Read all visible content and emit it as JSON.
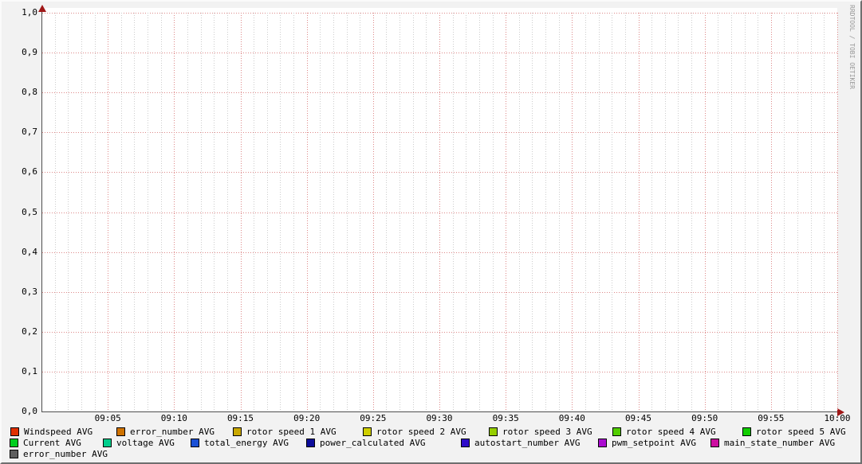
{
  "watermark": "RRDTOOL / TOBI OETIKER",
  "chart_data": {
    "type": "line",
    "title": "",
    "x_axis": {
      "range": [
        "09:00",
        "10:00"
      ],
      "tick_labels": [
        "09:05",
        "09:10",
        "09:15",
        "09:20",
        "09:25",
        "09:30",
        "09:35",
        "09:40",
        "09:45",
        "09:50",
        "09:55",
        "10:00"
      ],
      "minor_ticks_per_major": 5
    },
    "y_axis": {
      "min": 0.0,
      "max": 1.0,
      "tick_labels_top_to_bottom": [
        "1,0",
        "0,9",
        "0,8",
        "0,7",
        "0,6",
        "0,5",
        "0,4",
        "0,3",
        "0,2",
        "0,1",
        "0,0"
      ]
    },
    "grid": {
      "on": true,
      "major_color": "#dd8888",
      "minor_color": "#cccccc",
      "axis_color": "#4f4f4f",
      "arrow_color": "#a01818",
      "plot_bg": "#ffffff",
      "outer_bg": "#f2f2f2"
    },
    "legend_position": "bottom",
    "series": [
      {
        "name": "Windspeed AVG",
        "color": "#e03000",
        "values": []
      },
      {
        "name": "error_number AVG",
        "color": "#cf7300",
        "values": []
      },
      {
        "name": "rotor speed 1 AVG",
        "color": "#c9a800",
        "values": []
      },
      {
        "name": "rotor speed 2 AVG",
        "color": "#cfcf00",
        "values": []
      },
      {
        "name": "rotor speed 3 AVG",
        "color": "#95ce00",
        "values": []
      },
      {
        "name": "rotor speed 4 AVG",
        "color": "#52ce00",
        "values": []
      },
      {
        "name": "rotor speed 5 AVG",
        "color": "#12ce00",
        "values": []
      },
      {
        "name": "Current AVG",
        "color": "#00ce1f",
        "values": []
      },
      {
        "name": "voltage AVG",
        "color": "#00ce8c",
        "values": []
      },
      {
        "name": "total_energy AVG",
        "color": "#1b50d5",
        "values": []
      },
      {
        "name": "power_calculated AVG",
        "color": "#0c0c9a",
        "values": []
      },
      {
        "name": "autostart_number AVG",
        "color": "#2e0cc9",
        "values": []
      },
      {
        "name": "pwm_setpoint AVG",
        "color": "#ab0cd1",
        "values": []
      },
      {
        "name": "main_state_number AVG",
        "color": "#cc0da0",
        "values": []
      },
      {
        "name": "error_number AVG",
        "color": "#5e5e5e",
        "values": []
      }
    ]
  },
  "legend": {
    "rows": [
      [
        0,
        1,
        2,
        3,
        4,
        5,
        6
      ],
      [
        7,
        8,
        9,
        10,
        11,
        12,
        13
      ],
      [
        14
      ]
    ]
  }
}
